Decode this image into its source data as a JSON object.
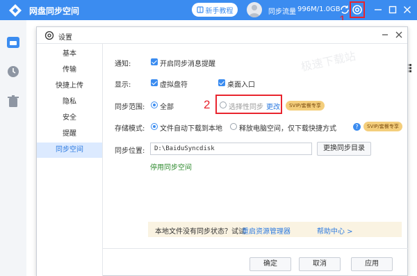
{
  "app": {
    "title": "网盘同步空间",
    "guide_label": "新手教程",
    "flow_label": "同步流量",
    "flow_value": "996M/1.0GB",
    "annotation_1": "1"
  },
  "dialog": {
    "title": "设置",
    "nav": [
      "基本",
      "传输",
      "快捷上传",
      "隐私",
      "安全",
      "提醒",
      "同步空间"
    ],
    "active_nav_index": 6,
    "notify": {
      "label": "通知:",
      "option": "开启同步消息提醒"
    },
    "display": {
      "label": "显示:",
      "option1": "虚拟盘符",
      "option2": "桌面入口"
    },
    "scope": {
      "label": "同步范围:",
      "option_all": "全部",
      "option_selective": "选择性同步",
      "change": "更改",
      "badge": "SVIP/套餐专享",
      "annotation_2": "2"
    },
    "storage": {
      "label": "存储模式:",
      "option1": "文件自动下载到本地",
      "option2": "释放电脑空间，仅下载快捷方式",
      "badge": "SVIP/套餐专享"
    },
    "location": {
      "label": "同步位置:",
      "path": "D:\\BaiduSyncdisk",
      "change_button": "更换同步目录",
      "disable_link": "停用同步空间"
    },
    "tip": {
      "text": "本地文件没有同步状态？试试",
      "restart_link": "重启资源管理器",
      "help_link": "帮助中心 >"
    },
    "buttons": {
      "ok": "确定",
      "cancel": "取消",
      "apply": "应用"
    },
    "watermark": "极速下载站"
  },
  "colors": {
    "accent": "#3b8cf0",
    "highlight": "#e8242e",
    "badge": "#f4ce7c"
  },
  "icons": [
    "app-logo-icon",
    "book-icon",
    "sync-icon",
    "gear-icon",
    "minimize-icon",
    "maximize-icon",
    "close-icon",
    "folder-icon",
    "clock-icon",
    "trash-icon",
    "grid-icon"
  ]
}
